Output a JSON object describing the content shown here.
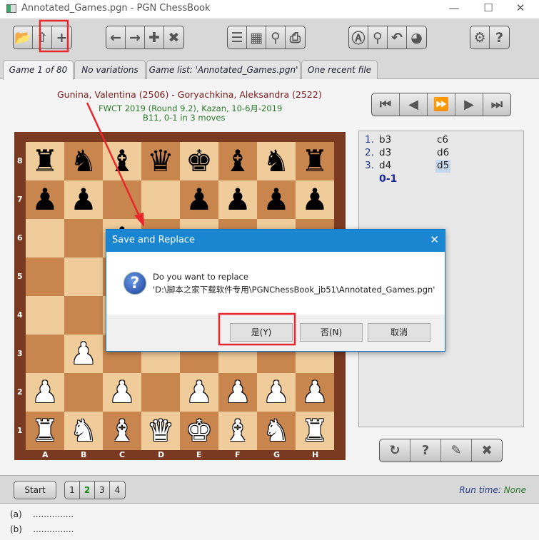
{
  "window": {
    "title": "Annotated_Games.pgn - PGN ChessBook",
    "minimize": "—",
    "maximize": "☐",
    "close": "✕"
  },
  "toolbar": {
    "groups": [
      [
        {
          "icon": "open-folder-icon",
          "glyph": "📂"
        },
        {
          "icon": "save-replace-icon",
          "glyph": "⇧"
        },
        {
          "icon": "new-file-icon",
          "glyph": "+"
        }
      ],
      [
        {
          "icon": "arrow-left-icon",
          "glyph": "←"
        },
        {
          "icon": "arrow-right-icon",
          "glyph": "→"
        },
        {
          "icon": "plus-icon",
          "glyph": "✚"
        },
        {
          "icon": "delete-icon",
          "glyph": "✖"
        }
      ],
      [
        {
          "icon": "player-list-icon",
          "glyph": "☰"
        },
        {
          "icon": "board-icon",
          "glyph": "▦"
        },
        {
          "icon": "search-annotation-icon",
          "glyph": "⚲"
        },
        {
          "icon": "print-icon",
          "glyph": "⎙"
        }
      ],
      [
        {
          "icon": "analyze-icon",
          "glyph": "Ⓐ"
        },
        {
          "icon": "search-position-icon",
          "glyph": "⚲"
        },
        {
          "icon": "search-back-icon",
          "glyph": "↶"
        },
        {
          "icon": "statistics-pie-icon",
          "glyph": "◕"
        }
      ],
      [
        {
          "icon": "settings-gear-icon",
          "glyph": "⚙"
        },
        {
          "icon": "help-book-icon",
          "glyph": "?"
        }
      ]
    ]
  },
  "tabs": [
    {
      "label": "Game 1 of 80",
      "active": true
    },
    {
      "label": "No variations"
    },
    {
      "label": "Game list:  'Annotated_Games.pgn'"
    },
    {
      "label": "One recent file"
    }
  ],
  "game": {
    "players": "Gunina, Valentina (2506) - Goryachkina, Aleksandra (2522)",
    "event": "FWCT 2019 (Round 9.2),  Kazan,  10-6月-2019",
    "eco": "B11,  0-1  in 3 moves"
  },
  "nav_buttons": [
    {
      "icon": "first-move-icon",
      "glyph": "⏮"
    },
    {
      "icon": "previous-move-icon",
      "glyph": "◀"
    },
    {
      "icon": "autoplay-icon",
      "glyph": "⏩"
    },
    {
      "icon": "next-move-icon",
      "glyph": "▶"
    },
    {
      "icon": "last-move-icon",
      "glyph": "⏭"
    }
  ],
  "board": {
    "ranks": [
      "rnbqkbnr",
      "pp..pppp",
      "..p.....",
      "...p....",
      "...P....",
      ".P......",
      "P.P.PPPP",
      "RNBQKBNR"
    ],
    "rank_labels": [
      "8",
      "7",
      "6",
      "5",
      "4",
      "3",
      "2",
      "1"
    ],
    "file_labels": [
      "A",
      "B",
      "C",
      "D",
      "E",
      "F",
      "G",
      "H"
    ],
    "colors": {
      "light": "#f0cc9a",
      "dark": "#c8864e",
      "frame": "#7a3a22"
    }
  },
  "moves": [
    {
      "num": "1.",
      "white": "b3",
      "black": "c6"
    },
    {
      "num": "2.",
      "white": "d3",
      "black": "d6"
    },
    {
      "num": "3.",
      "white": "d4",
      "black": "d5",
      "selected": true
    }
  ],
  "result": "0-1",
  "action_buttons": [
    {
      "icon": "flip-board-icon",
      "glyph": "↻"
    },
    {
      "icon": "player-info-icon",
      "glyph": "?"
    },
    {
      "icon": "edit-icon",
      "glyph": "✎"
    },
    {
      "icon": "close-x-icon",
      "glyph": "✖"
    }
  ],
  "bottom": {
    "start": "Start",
    "pages": [
      "1",
      "2",
      "3",
      "4"
    ],
    "active_page": "2",
    "runtime_label": "Run time:",
    "runtime_value": "None"
  },
  "annotations": [
    {
      "label": "(a)",
      "value": "...............",
      "dots": true
    },
    {
      "label": "(b)",
      "value": "..............."
    }
  ],
  "dialog": {
    "title": "Save and Replace",
    "line1": "Do you want to replace",
    "line2": "'D:\\脚本之家下载软件专用\\PGNChessBook_jb51\\Annotated_Games.pgn'",
    "yes": "是(Y)",
    "no": "否(N)",
    "cancel": "取消",
    "icon": "question-icon"
  },
  "highlight_color": "#e8262b"
}
